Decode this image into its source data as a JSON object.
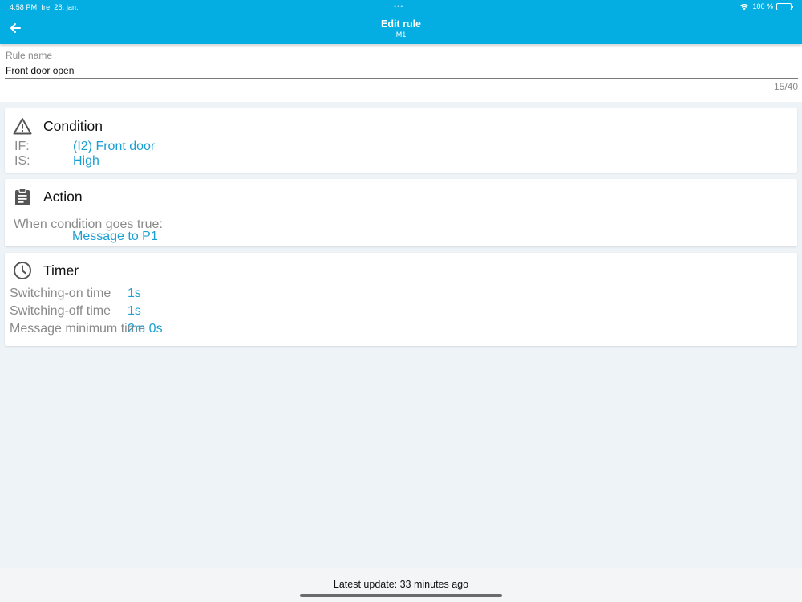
{
  "status_bar": {
    "time": "4.58 PM",
    "date": "fre. 28. jan.",
    "dots": "•••",
    "battery_text": "100 %"
  },
  "header": {
    "title": "Edit rule",
    "subtitle": "M1",
    "back_icon": "arrow-left-icon"
  },
  "rule_name": {
    "label": "Rule name",
    "value": "Front door open",
    "counter": "15/40"
  },
  "condition": {
    "title": "Condition",
    "icon": "warning-triangle-icon",
    "if_label": "IF:",
    "if_value": "(I2) Front door",
    "is_label": "IS:",
    "is_value": "High"
  },
  "action": {
    "title": "Action",
    "icon": "clipboard-icon",
    "when_label": "When condition goes true:",
    "when_value": "Message to P1"
  },
  "timer": {
    "title": "Timer",
    "icon": "clock-icon",
    "rows": [
      {
        "label": "Switching-on time",
        "value": "1s"
      },
      {
        "label": "Switching-off time",
        "value": "1s"
      },
      {
        "label": "Message minimum time",
        "value": "2m 0s"
      }
    ]
  },
  "footer": {
    "text": "Latest update: 33 minutes ago"
  },
  "colors": {
    "accent": "#05aee2",
    "link": "#1a9fd3",
    "background": "#eef3f7"
  }
}
